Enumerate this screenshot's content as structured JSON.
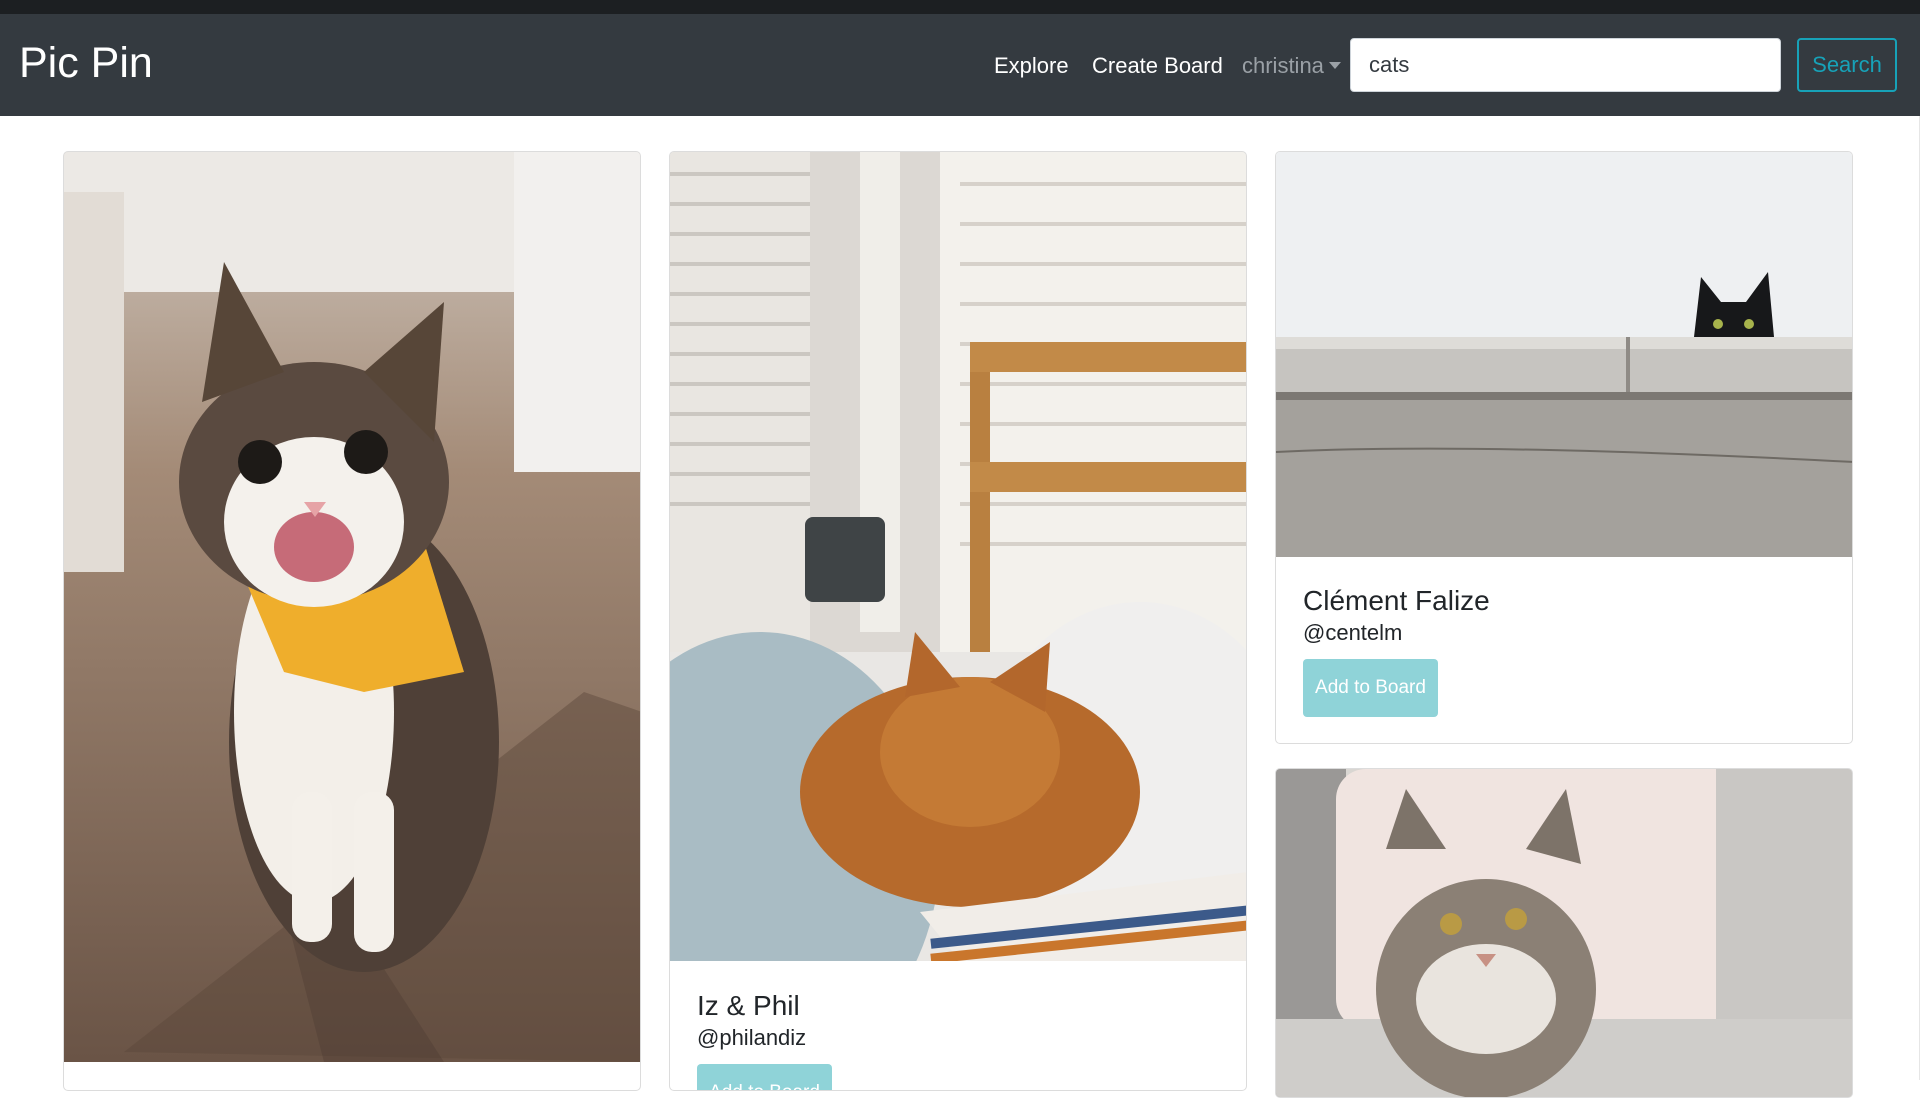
{
  "navbar": {
    "brand": "Pic Pin",
    "links": {
      "explore": "Explore",
      "create_board": "Create Board",
      "user": "christina"
    },
    "search": {
      "value": "cats",
      "button": "Search"
    }
  },
  "pins": [
    {
      "name": "",
      "handle": "",
      "image": "cat-with-yellow-bandana"
    },
    {
      "name": "Iz & Phil",
      "handle": "@philandiz",
      "image": "orange-cat-sleeping-in-bed",
      "button": "Add to Board"
    },
    {
      "name": "Clément Falize",
      "handle": "@centelm",
      "image": "black-cat-peeking-over-wall",
      "button": "Add to Board"
    },
    {
      "name": "",
      "handle": "",
      "image": "tabby-cat-on-sofa"
    }
  ],
  "colors": {
    "navbar": "#343a40",
    "accent": "#17a2b8",
    "add_button": "#8fd3d8"
  }
}
